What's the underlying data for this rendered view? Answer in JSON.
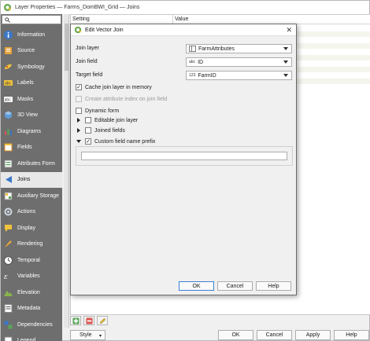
{
  "window": {
    "title": "Layer Properties — Farms_DomBWI_Grid — Joins"
  },
  "sidebar": {
    "items": [
      {
        "label": "Information",
        "icon": "information-icon"
      },
      {
        "label": "Source",
        "icon": "source-icon"
      },
      {
        "label": "Symbology",
        "icon": "symbology-icon"
      },
      {
        "label": "Labels",
        "icon": "labels-icon"
      },
      {
        "label": "Masks",
        "icon": "masks-icon"
      },
      {
        "label": "3D View",
        "icon": "3d-view-icon"
      },
      {
        "label": "Diagrams",
        "icon": "diagrams-icon"
      },
      {
        "label": "Fields",
        "icon": "fields-icon"
      },
      {
        "label": "Attributes Form",
        "icon": "attributes-form-icon"
      },
      {
        "label": "Joins",
        "icon": "joins-icon"
      },
      {
        "label": "Auxiliary Storage",
        "icon": "auxiliary-storage-icon"
      },
      {
        "label": "Actions",
        "icon": "actions-icon"
      },
      {
        "label": "Display",
        "icon": "display-icon"
      },
      {
        "label": "Rendering",
        "icon": "rendering-icon"
      },
      {
        "label": "Temporal",
        "icon": "temporal-icon"
      },
      {
        "label": "Variables",
        "icon": "variables-icon"
      },
      {
        "label": "Elevation",
        "icon": "elevation-icon"
      },
      {
        "label": "Metadata",
        "icon": "metadata-icon"
      },
      {
        "label": "Dependencies",
        "icon": "dependencies-icon"
      },
      {
        "label": "Legend",
        "icon": "legend-icon"
      }
    ],
    "active": "Joins"
  },
  "table": {
    "col_setting": "Setting",
    "col_value": "Value"
  },
  "footer": {
    "style": "Style",
    "ok": "OK",
    "cancel": "Cancel",
    "apply": "Apply",
    "help": "Help"
  },
  "dialog": {
    "title": "Edit Vector Join",
    "join_layer_label": "Join layer",
    "join_layer_value": "FarmAttributes",
    "join_field_label": "Join field",
    "join_field_type": "abc",
    "join_field_value": "ID",
    "target_field_label": "Target field",
    "target_field_type": "123",
    "target_field_value": "FarmID",
    "cache_label": "Cache join layer in memory",
    "cache_checked": true,
    "index_label": "Create attribute index on join field",
    "dynamic_label": "Dynamic form",
    "editable_label": "Editable join layer",
    "joined_fields_label": "Joined fields",
    "prefix_label": "Custom field name prefix",
    "prefix_value": "",
    "ok": "OK",
    "cancel": "Cancel",
    "help": "Help"
  },
  "colors": {
    "sidebar_bg": "#6e6e6e",
    "active_bg": "#e8e8e8",
    "accent": "#3c7fd6"
  }
}
